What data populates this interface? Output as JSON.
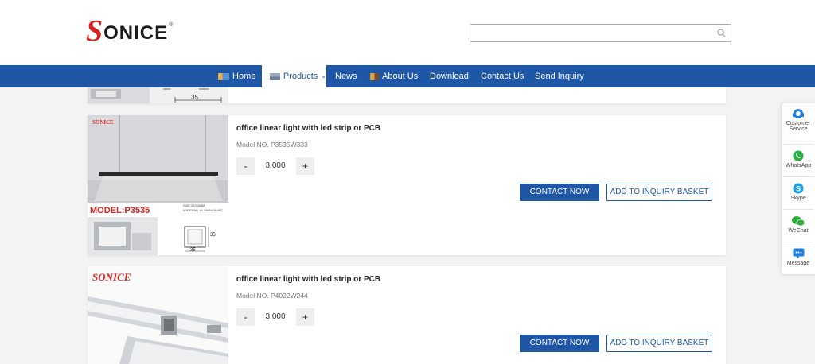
{
  "brand": {
    "logo_first": "S",
    "logo_rest": "ONICE",
    "logo_reg": "®"
  },
  "search": {
    "placeholder": "",
    "icon": "search-icon"
  },
  "nav": {
    "items": [
      {
        "label": "Home",
        "icon": "home-flag-icon"
      },
      {
        "label": "Products",
        "icon": "products-icon",
        "dropdown": "⌄"
      },
      {
        "label": "News"
      },
      {
        "label": "About Us",
        "icon": "about-flag-icon"
      },
      {
        "label": "Download"
      },
      {
        "label": "Contact Us"
      },
      {
        "label": "Send Inquiry"
      }
    ],
    "active": "Products"
  },
  "products": [
    {
      "thumb_brand": "SONICE",
      "thumb_model": "MODEL:P3535",
      "thumb_spec_line1": "SIZE:35*35MM",
      "thumb_spec_line2": "MATERIAL:ALUMINUM+PC",
      "thumb_dim_a": "35",
      "thumb_dim_b": "35",
      "title": "office linear light with led strip or PCB",
      "model": "Model NO. P3535W333",
      "qty": "3,000",
      "minus": "-",
      "plus": "+",
      "contact": "CONTACT NOW",
      "basket": "ADD TO INQUIRY BASKET"
    },
    {
      "thumb_brand": "SONICE",
      "title": "office linear light with led strip or PCB",
      "model": "Model NO. P4022W244",
      "qty": "3,000",
      "minus": "-",
      "plus": "+",
      "contact": "CONTACT NOW",
      "basket": "ADD TO INQUIRY BASKET"
    }
  ],
  "top_partial": {
    "dim": "35"
  },
  "side_panel": [
    {
      "label_1": "Customer",
      "label_2": "Service",
      "icon": "headset-icon",
      "color": "#1f7de0"
    },
    {
      "label_1": "WhatsApp",
      "icon": "whatsapp-icon",
      "color": "#25b140"
    },
    {
      "label_1": "Skype",
      "icon": "skype-icon",
      "color": "#1ba1e2"
    },
    {
      "label_1": "WeChat",
      "icon": "wechat-icon",
      "color": "#2aae38"
    },
    {
      "label_1": "Message",
      "icon": "message-icon",
      "color": "#1f7de0"
    }
  ],
  "colors": {
    "nav_bg": "#1f56a5",
    "brand_red": "#d2231e",
    "page_bg": "#f3f3f3"
  }
}
